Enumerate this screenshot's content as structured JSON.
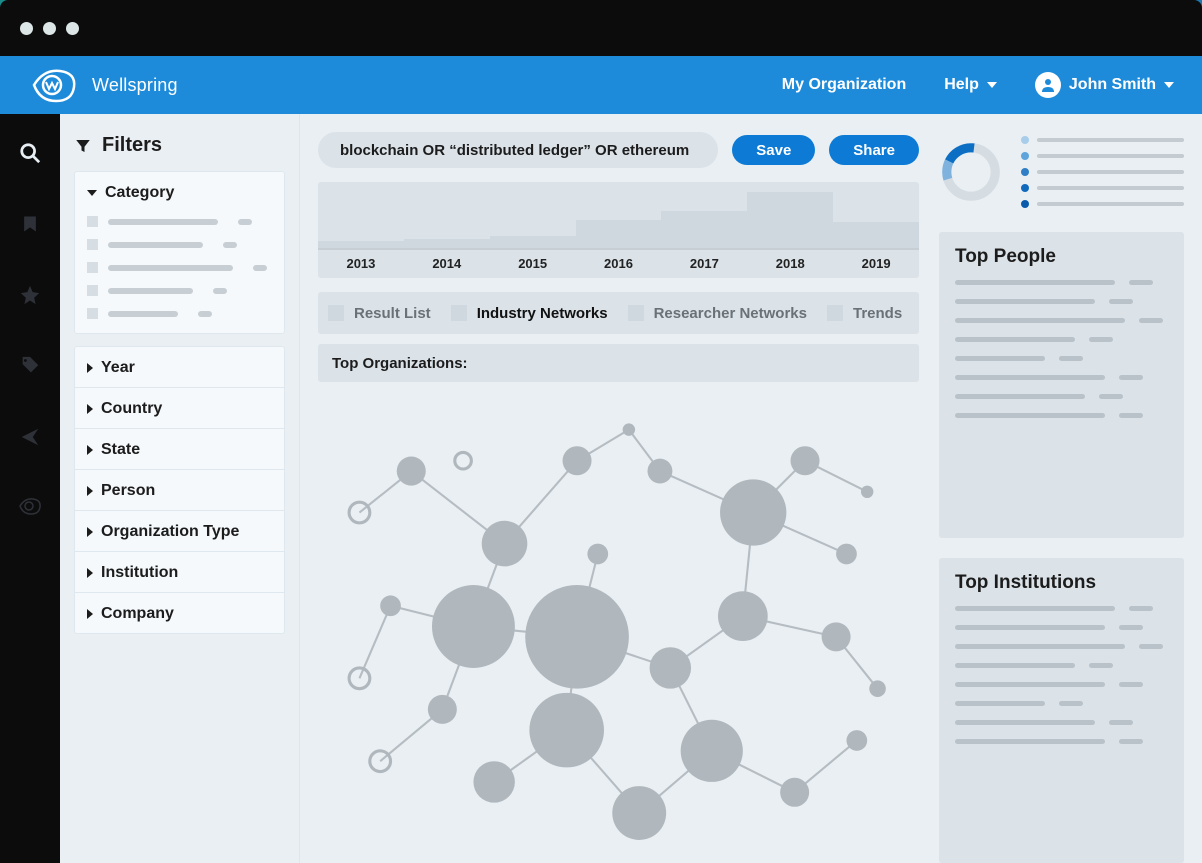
{
  "brand": "Wellspring",
  "topnav": {
    "my_org": "My Organization",
    "help": "Help",
    "user": "John Smith"
  },
  "rail_icons": [
    "search-icon",
    "bookmark-icon",
    "star-icon",
    "tag-icon",
    "share-icon",
    "wellspring-icon"
  ],
  "filters": {
    "title": "Filters",
    "category": {
      "label": "Category",
      "placeholder_rows": 5
    },
    "collapsed": [
      "Year",
      "Country",
      "State",
      "Person",
      "Organization Type",
      "Institution",
      "Company"
    ]
  },
  "search": {
    "query": "blockchain OR “distributed ledger” OR ethereum",
    "save": "Save",
    "share": "Share"
  },
  "timeline": {
    "years": [
      "2013",
      "2014",
      "2015",
      "2016",
      "2017",
      "2018",
      "2019"
    ]
  },
  "chart_data": {
    "type": "bar",
    "categories": [
      "2013",
      "2014",
      "2015",
      "2016",
      "2017",
      "2018",
      "2019"
    ],
    "values": [
      6,
      8,
      10,
      24,
      32,
      48,
      22
    ],
    "xlabel": "",
    "ylabel": "",
    "ylim": [
      0,
      50
    ]
  },
  "tabs": [
    {
      "label": "Result List",
      "active": false
    },
    {
      "label": "Industry Networks",
      "active": true
    },
    {
      "label": "Researcher Networks",
      "active": false
    },
    {
      "label": "Trends",
      "active": false
    }
  ],
  "orgs_label": "Top Organizations:",
  "legend_colors": [
    "#a8cdea",
    "#5fa5db",
    "#2f7ec6",
    "#126abd",
    "#0a5aab"
  ],
  "panels": {
    "people": "Top People",
    "institutions": "Top Institutions"
  }
}
